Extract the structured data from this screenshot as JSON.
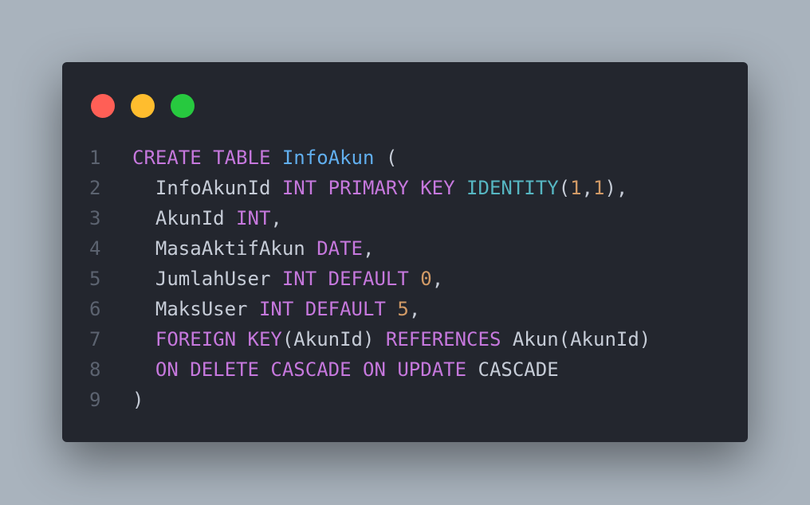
{
  "window": {
    "controls": [
      {
        "name": "close",
        "color": "#ff5f56"
      },
      {
        "name": "minimize",
        "color": "#ffbd2e"
      },
      {
        "name": "maximize",
        "color": "#27c93f"
      }
    ]
  },
  "colors": {
    "background": "#a9b3bd",
    "editor_bg": "#23262e",
    "keyword": "#c678dd",
    "function": "#61afef",
    "identity": "#56b6c2",
    "number": "#d19a66",
    "plain": "#c6ccd7",
    "line_number": "#5c6370"
  },
  "code": {
    "language": "sql",
    "lines": [
      {
        "number": "1",
        "tokens": [
          {
            "t": "CREATE TABLE",
            "k": "kw"
          },
          {
            "t": " ",
            "k": "plain"
          },
          {
            "t": "InfoAkun",
            "k": "fn"
          },
          {
            "t": " (",
            "k": "plain"
          }
        ]
      },
      {
        "number": "2",
        "tokens": [
          {
            "t": "  InfoAkunId ",
            "k": "plain"
          },
          {
            "t": "INT PRIMARY KEY",
            "k": "kw"
          },
          {
            "t": " ",
            "k": "plain"
          },
          {
            "t": "IDENTITY",
            "k": "id"
          },
          {
            "t": "(",
            "k": "plain"
          },
          {
            "t": "1",
            "k": "num"
          },
          {
            "t": ",",
            "k": "plain"
          },
          {
            "t": "1",
            "k": "num"
          },
          {
            "t": "),",
            "k": "plain"
          }
        ]
      },
      {
        "number": "3",
        "tokens": [
          {
            "t": "  AkunId ",
            "k": "plain"
          },
          {
            "t": "INT",
            "k": "kw"
          },
          {
            "t": ",",
            "k": "plain"
          }
        ]
      },
      {
        "number": "4",
        "tokens": [
          {
            "t": "  MasaAktifAkun ",
            "k": "plain"
          },
          {
            "t": "DATE",
            "k": "kw"
          },
          {
            "t": ",",
            "k": "plain"
          }
        ]
      },
      {
        "number": "5",
        "tokens": [
          {
            "t": "  JumlahUser ",
            "k": "plain"
          },
          {
            "t": "INT DEFAULT",
            "k": "kw"
          },
          {
            "t": " ",
            "k": "plain"
          },
          {
            "t": "0",
            "k": "num"
          },
          {
            "t": ",",
            "k": "plain"
          }
        ]
      },
      {
        "number": "6",
        "tokens": [
          {
            "t": "  MaksUser ",
            "k": "plain"
          },
          {
            "t": "INT DEFAULT",
            "k": "kw"
          },
          {
            "t": " ",
            "k": "plain"
          },
          {
            "t": "5",
            "k": "num"
          },
          {
            "t": ",",
            "k": "plain"
          }
        ]
      },
      {
        "number": "7",
        "tokens": [
          {
            "t": "  ",
            "k": "plain"
          },
          {
            "t": "FOREIGN KEY",
            "k": "kw"
          },
          {
            "t": "(AkunId) ",
            "k": "plain"
          },
          {
            "t": "REFERENCES",
            "k": "kw"
          },
          {
            "t": " Akun(AkunId)",
            "k": "plain"
          }
        ]
      },
      {
        "number": "8",
        "tokens": [
          {
            "t": "  ",
            "k": "plain"
          },
          {
            "t": "ON DELETE CASCADE ON UPDATE",
            "k": "kw"
          },
          {
            "t": " CASCADE",
            "k": "plain"
          }
        ]
      },
      {
        "number": "9",
        "tokens": [
          {
            "t": ")",
            "k": "plain"
          }
        ]
      }
    ]
  }
}
